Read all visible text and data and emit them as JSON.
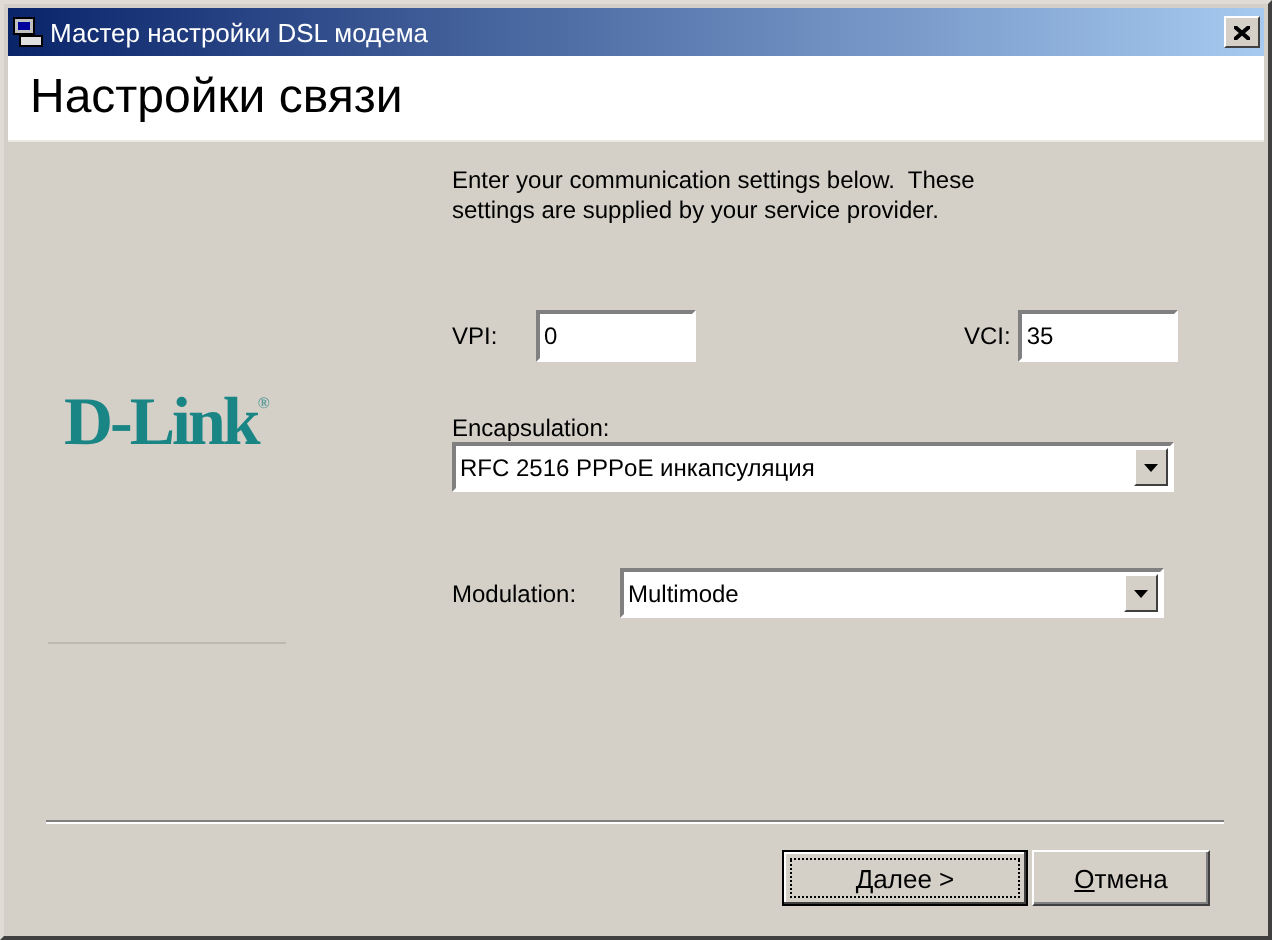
{
  "window": {
    "title": "Мастер настройки DSL модема"
  },
  "header": {
    "title": "Настройки связи"
  },
  "logo": {
    "text": "D-Link",
    "mark": "®"
  },
  "intro": "Enter your communication settings below.  These settings are supplied by your service provider.",
  "vpi": {
    "label": "VPI:",
    "value": "0"
  },
  "vci": {
    "label": "VCI:",
    "value": "35"
  },
  "encapsulation": {
    "label": "Encapsulation:",
    "value": "RFC 2516 PPPoE инкапсуляция"
  },
  "modulation": {
    "label": "Modulation:",
    "value": "Multimode"
  },
  "buttons": [
    {
      "label": "Далее >",
      "default": true
    },
    {
      "label": "Отмена",
      "default": false
    }
  ]
}
